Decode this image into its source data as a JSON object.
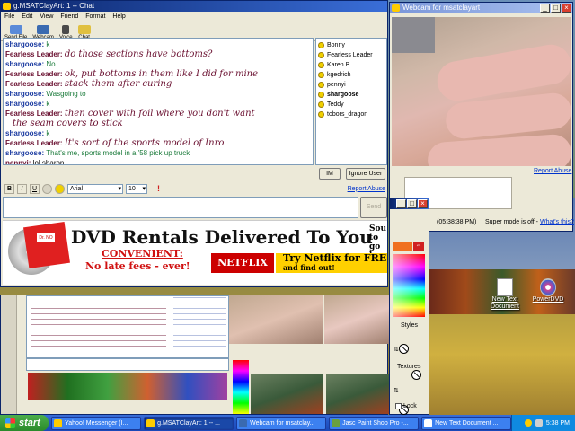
{
  "chat_window": {
    "title": "g.MSATClayArt: 1 -- Chat",
    "menu": [
      "File",
      "Edit",
      "View",
      "Friend",
      "Format",
      "Help"
    ],
    "toolbar": [
      "Send File",
      "Webcam",
      "Voice",
      "Chat"
    ],
    "messages": [
      {
        "who": "shargoose:",
        "text": "k",
        "style": "sg"
      },
      {
        "who": "Fearless Leader:",
        "text": "do those sections have bottoms?",
        "style": "fl"
      },
      {
        "who": "shargoose:",
        "text": "No",
        "style": "sg"
      },
      {
        "who": "Fearless Leader:",
        "text": "ok, put bottoms in them like I did for mine",
        "style": "fl"
      },
      {
        "who": "Fearless Leader:",
        "text": "stack them after curing",
        "style": "fl"
      },
      {
        "who": "shargoose:",
        "text": "Wasgoing to",
        "style": "sg"
      },
      {
        "who": "shargoose:",
        "text": "k",
        "style": "sg"
      },
      {
        "who": "Fearless Leader:",
        "text": "then cover with foil where you don't want",
        "style": "fl"
      },
      {
        "who": "",
        "text": "the seam covers to stick",
        "style": "fl"
      },
      {
        "who": "shargoose:",
        "text": "k",
        "style": "sg"
      },
      {
        "who": "Fearless Leader:",
        "text": "It's sort of the sports model of Inro",
        "style": "fl"
      },
      {
        "who": "shargoose:",
        "text": "That's me, sports model in a '58 pick up truck",
        "style": "sg"
      },
      {
        "who": "pennyi:",
        "text": "lol sharon",
        "style": "pn"
      }
    ],
    "users": [
      {
        "name": "Bonny",
        "bold": false
      },
      {
        "name": "Fearless Leader",
        "bold": false
      },
      {
        "name": "Karen B",
        "bold": false
      },
      {
        "name": "kgedrich",
        "bold": false
      },
      {
        "name": "pennyi",
        "bold": false
      },
      {
        "name": "shargoose",
        "bold": true
      },
      {
        "name": "Teddy",
        "bold": false
      },
      {
        "name": "tobors_dragon",
        "bold": false
      }
    ],
    "im_label": "IM",
    "ignore_label": "Ignore User",
    "report_abuse": "Report Abuse",
    "format": {
      "bold": "B",
      "italic": "I",
      "underline": "U",
      "font": "Arial",
      "size": "10"
    },
    "send_label": "Send"
  },
  "ad": {
    "headline": "DVD Rentals Delivered To You",
    "convenient": "CONVENIENT:",
    "fees": "No late fees - ever!",
    "brand": "NETFLIX",
    "try_line": "Try Netflix for FRE",
    "try_sub": "and find out!",
    "envelope_tag": "Dr. NO",
    "side_text": "Sou to go be"
  },
  "webcam_window": {
    "title": "Webcam for msatclayart",
    "report_abuse": "Report Abuse",
    "timestamp": "(05:38:38 PM)",
    "super_mode": "Super mode is off -",
    "whats_this": "What's this?"
  },
  "palette": {
    "styles_label": "Styles",
    "textures_label": "Textures",
    "lock_label": "Lock"
  },
  "desktop_icons": [
    {
      "label": "New Text Document"
    },
    {
      "label": "PowerDVD"
    }
  ],
  "taskbar": {
    "start": "start",
    "tasks": [
      {
        "label": "Yahoo! Messenger (I...",
        "active": false
      },
      {
        "label": "g.MSATClayArt: 1 -- ...",
        "active": true
      },
      {
        "label": "Webcam for msatclay...",
        "active": false
      },
      {
        "label": "Jasc Paint Shop Pro -...",
        "active": false
      },
      {
        "label": "New Text Document ...",
        "active": false
      }
    ],
    "clock": "5:38 PM"
  },
  "colors": {
    "accent": "#0a246a",
    "fearless": "#6a1030",
    "shargoose_name": "#1a3aa0",
    "shargoose_text": "#1a7a3a",
    "ad_red": "#d01010"
  }
}
